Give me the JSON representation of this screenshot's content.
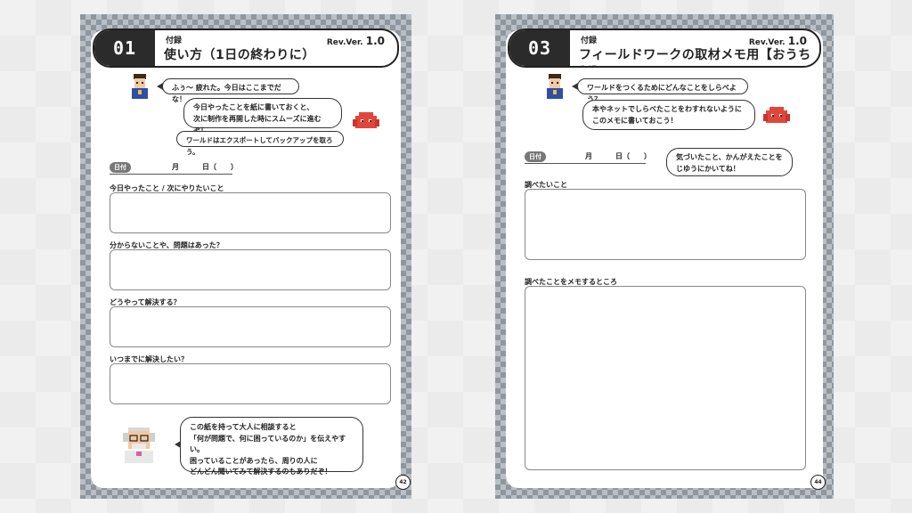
{
  "left_page": {
    "header": {
      "number": "01",
      "tag": "付録",
      "title": "使い方（1日の終わりに）",
      "version_prefix": "Rev.Ver.",
      "version": "1.0"
    },
    "dialog": {
      "line1": "ふぅ〜 疲れた。今日はここまでだな！",
      "line2a": "今日やったことを紙に書いておくと、",
      "line2b": "次に制作を再開した時にスムーズに進むぞ！",
      "line3": "ワールドはエクスポートしてバックアップを取ろう。"
    },
    "date": {
      "tag": "日付",
      "month": "月",
      "day": "日（　　）"
    },
    "fields": [
      {
        "label": "今日やったこと / 次にやりたいこと"
      },
      {
        "label": "分からないことや、問題はあった？"
      },
      {
        "label": "どうやって解決する？"
      },
      {
        "label": "いつまでに解決したい？"
      }
    ],
    "advice": {
      "line1": "この紙を持って大人に相談すると",
      "line2": "「何が問題で、何に困っているのか」を伝えやすい。",
      "line3": "困っていることがあったら、周りの人に",
      "line4": "どんどん聞いてみて解決するのもありだぞ！"
    },
    "page_number": "42"
  },
  "right_page": {
    "header": {
      "number": "03",
      "tag": "付録",
      "title": "フィールドワークの取材メモ用【おうち版】",
      "version_prefix": "Rev.Ver.",
      "version": "1.0"
    },
    "dialog": {
      "line1": "ワールドをつくるためにどんなことをしらべよう？",
      "line2a": "本やネットでしらべたことをわすれないように",
      "line2b": "このメモに書いておこう！"
    },
    "date": {
      "tag": "日付",
      "month": "月",
      "day": "日（　　）"
    },
    "note_bubble": {
      "line1": "気づいたこと、かんがえたことを",
      "line2": "じゆうにかいてね！"
    },
    "fields": [
      {
        "label": "調べたいこと"
      },
      {
        "label": "調べたことをメモするところ"
      }
    ],
    "page_number": "44"
  },
  "colors": {
    "frame_dark": "#8e969e",
    "frame_light": "#b9bfc5",
    "header_dark": "#2b2b2b",
    "monster_red": "#e2463b"
  },
  "icons": [
    "boy-character-icon",
    "red-monster-icon",
    "old-man-character-icon"
  ]
}
